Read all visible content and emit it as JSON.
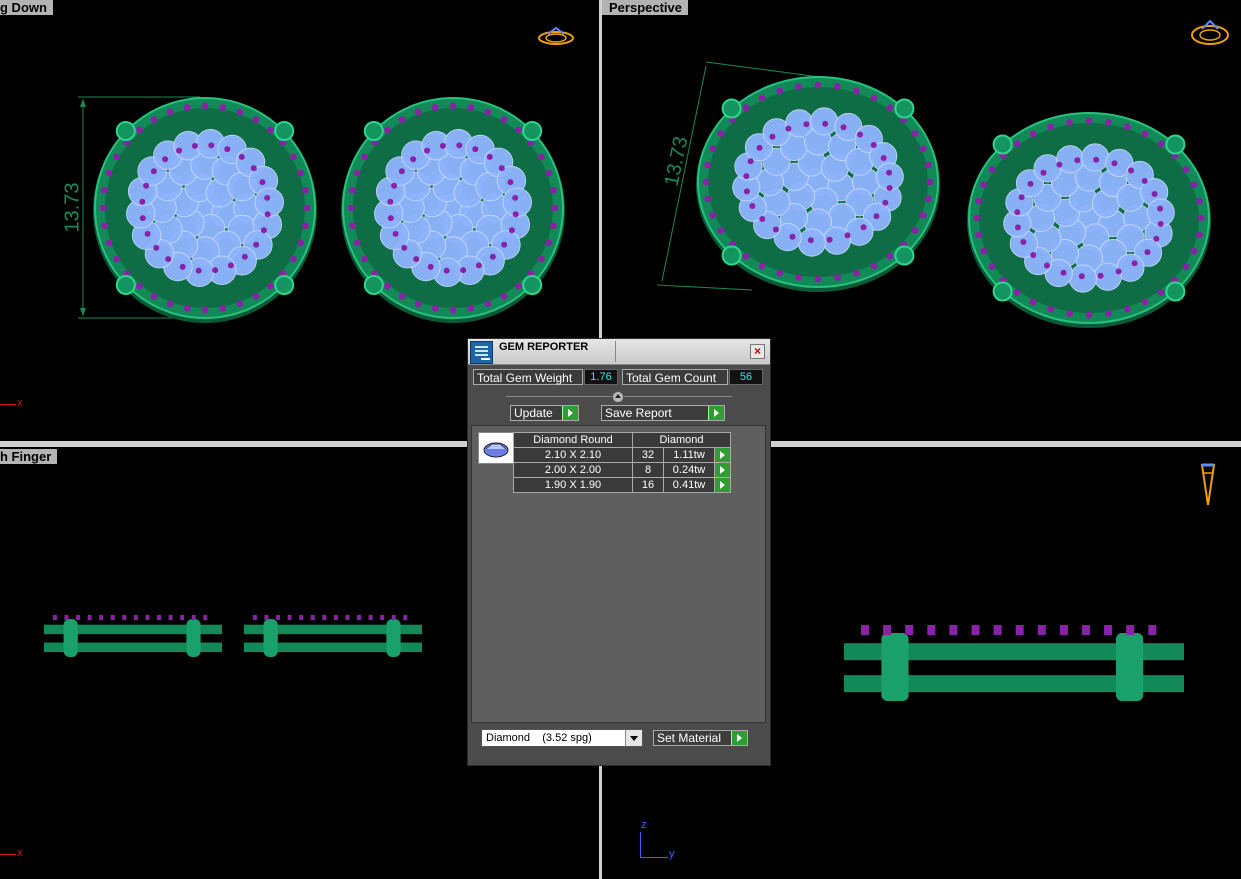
{
  "viewports": {
    "top_left": {
      "title": "g Down",
      "dimension": "13.73",
      "axis_x": "x"
    },
    "top_right": {
      "title": "Perspective",
      "dimension": "13.73"
    },
    "bottom_left": {
      "title": "h Finger",
      "axis_x": "x"
    },
    "bottom_right": {
      "axis_z": "z",
      "axis_y": "y"
    }
  },
  "gem_reporter": {
    "title": "GEM REPORTER",
    "total_weight_label": "Total Gem Weight",
    "total_weight_value": "1.76",
    "total_count_label": "Total Gem Count",
    "total_count_value": "56",
    "update_label": "Update",
    "save_report_label": "Save Report",
    "table": {
      "headers": [
        "Diamond Round",
        "Diamond"
      ],
      "rows": [
        {
          "size": "2.10 X 2.10",
          "count": "32",
          "weight": "1.11tw"
        },
        {
          "size": "2.00 X 2.00",
          "count": "8",
          "weight": "0.24tw"
        },
        {
          "size": "1.90 X 1.90",
          "count": "16",
          "weight": "0.41tw"
        }
      ]
    },
    "material_select": "Diamond    (3.52 spg)",
    "set_material_label": "Set Material"
  },
  "colors": {
    "metal": "#128a58",
    "gem": "#8fb4ff",
    "accent_gem": "#8a22a8",
    "dimension": "#188a55"
  }
}
